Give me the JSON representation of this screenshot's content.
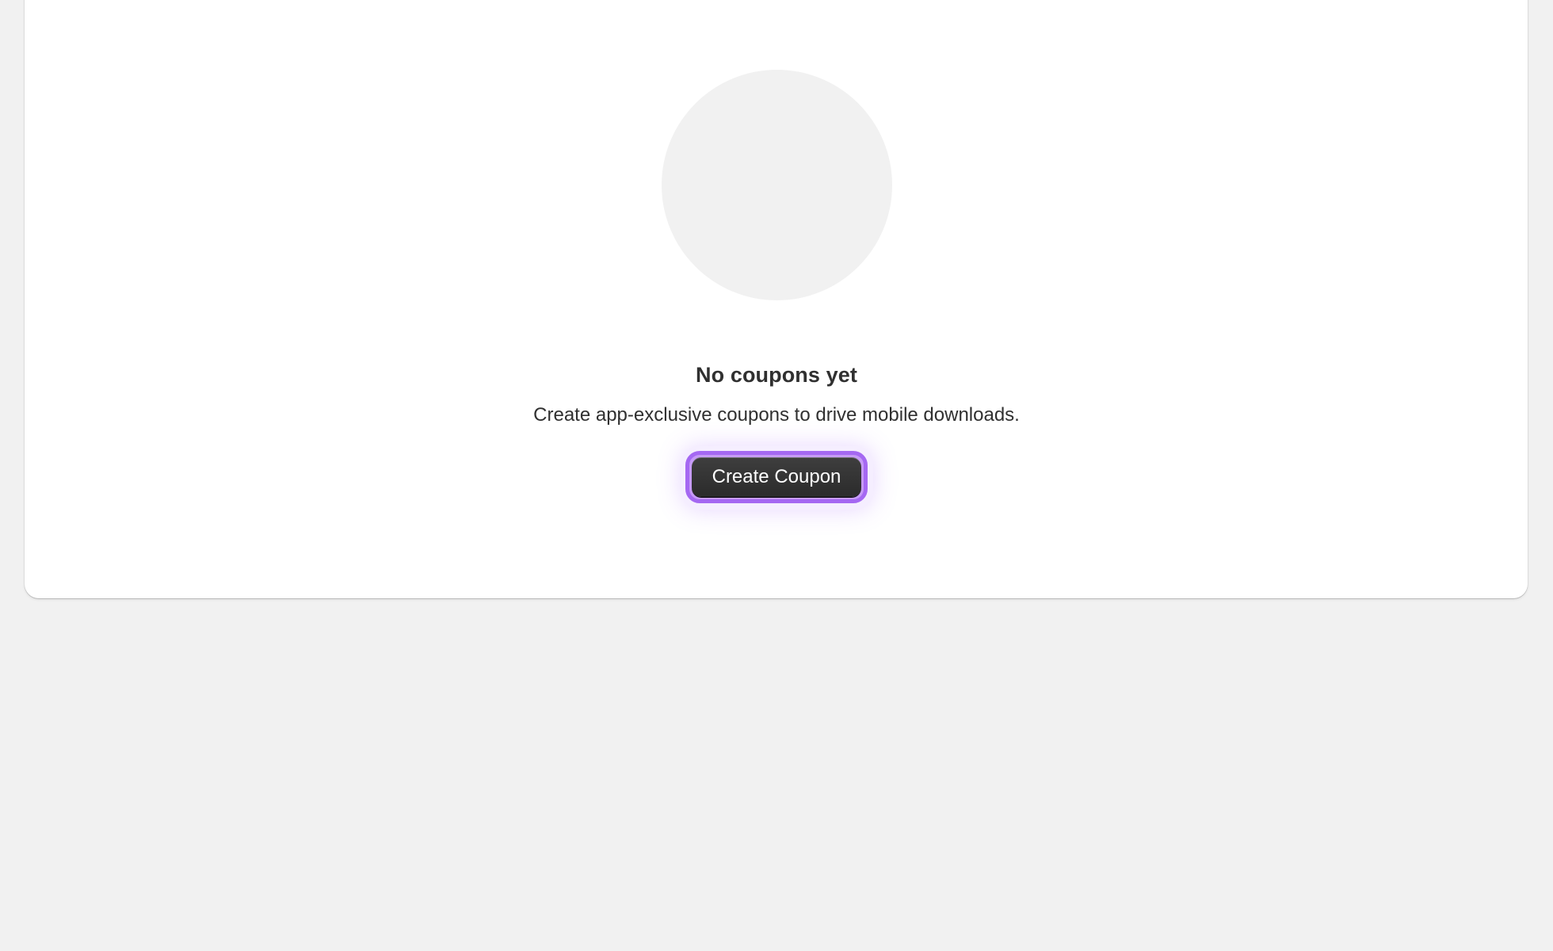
{
  "empty_state": {
    "illustration_icon": "empty-illustration-circle",
    "heading": "No coupons yet",
    "description": "Create app-exclusive coupons to drive mobile downloads.",
    "primary_action_label": "Create Coupon"
  },
  "colors": {
    "page_background": "#f1f1f1",
    "card_background": "#ffffff",
    "text_primary": "#303030",
    "button_background": "#303030",
    "focus_ring": "#a568f2"
  }
}
